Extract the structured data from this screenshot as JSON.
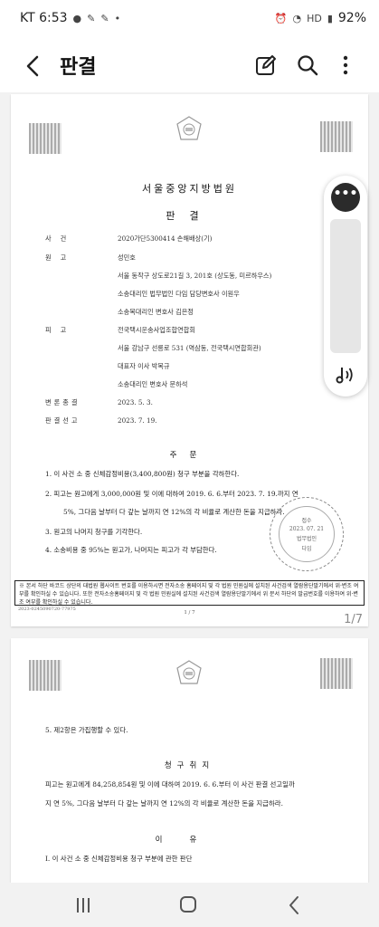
{
  "status_bar": {
    "carrier_time": "KT 6:53",
    "notif_icons": [
      "kakaotalk-icon",
      "pen-icon",
      "pen-icon",
      "dot-icon"
    ],
    "right_icons": [
      "alarm-icon",
      "wifi-icon",
      "hd-icon",
      "signal-icon"
    ],
    "battery_percent": "92%"
  },
  "app_bar": {
    "title": "판결",
    "actions": [
      "edit-icon",
      "search-icon",
      "more-vertical-icon"
    ]
  },
  "page1": {
    "court": "서울중앙지방법원",
    "doc_type": "판결",
    "rows": [
      {
        "label": "사건",
        "value": "2020가단5300414 손해배상(기)"
      },
      {
        "label": "원고",
        "value": "성민호"
      },
      {
        "label": "",
        "value": "서울 동작구 상도로21길 3, 201호 (상도동, 미르하우스)"
      },
      {
        "label": "",
        "value": "소송대리인 법무법인 다임 담당변호사 이원우"
      },
      {
        "label": "",
        "value": "소송복대리인 변호사 김은정"
      },
      {
        "label": "피고",
        "value": "전국택시운송사업조합연합회"
      },
      {
        "label": "",
        "value": "서울 강남구 선릉로 531 (역삼동, 전국택시연합회관)"
      },
      {
        "label": "",
        "value": "대표자 이사 박복규"
      },
      {
        "label": "",
        "value": "소송대리인 변호사 문하석"
      },
      {
        "label": "변론종결",
        "value": "2023. 5. 3."
      },
      {
        "label": "판결선고",
        "value": "2023. 7. 19."
      }
    ],
    "order_title": "주문",
    "order_lines": [
      "1. 이 사건 소 중 신체감정비용(3,400,800원) 청구 부분을 각하한다.",
      "2. 피고는 원고에게 3,000,000원 및 이에 대하여 2019. 6. 6.부터 2023. 7. 19.까지 연",
      "5%, 그다음 날부터 다 갚는 날까지 연 12%의 각 비율로 계산한 돈을 지급하라.",
      "3. 원고의 나머지 청구를 기각한다.",
      "4. 소송비용 중 95%는 원고가, 나머지는 피고가 각 부담한다."
    ],
    "notice": "※ 본서 하단 바코드 상단의 대법원 웹사이트 번호를 이용하시면 전자소송 홈페이지 및 각 법원 민원실에 설치된 사건검색 열람용단말기에서 위·변조 여부를 확인하실 수 있습니다. 또한 전자소송홈페이지 및 각 법원 민원실에 설치된 사건검색 열람용단말기에서 위 문서 하단의 발급번호를 이용하여 위·변조 여부를 확인하실 수 있습니다.",
    "issue_no": "2023-0245090720-77975",
    "page_label": "1 / 7",
    "seal_lines": [
      "접수",
      "2023. 07. 21",
      "법무법인",
      "다임"
    ]
  },
  "page_indicator": "1/7",
  "page2": {
    "item5": "5. 제2항은 가집행할 수 있다.",
    "claim_title": "청구취지",
    "claim_lines": [
      "피고는 원고에게 84,258,854원 및 이에 대하여 2019. 6. 6.부터 이 사건 판결 선고일까",
      "지 연 5%, 그다음 날부터 다 갚는 날까지 연 12%의 각 비율로 계산한 돈을 지급하라."
    ],
    "reason_title": "이유",
    "reason_line": "I. 이 사건 소 중 신체감정비용 청구 부분에 관한 판단"
  },
  "floating_toolbar": {
    "icons": [
      "more-horizontal-icon",
      "audio-read-icon"
    ]
  },
  "nav_bar": {
    "icons": [
      "recent-apps-icon",
      "home-icon",
      "back-icon"
    ]
  }
}
